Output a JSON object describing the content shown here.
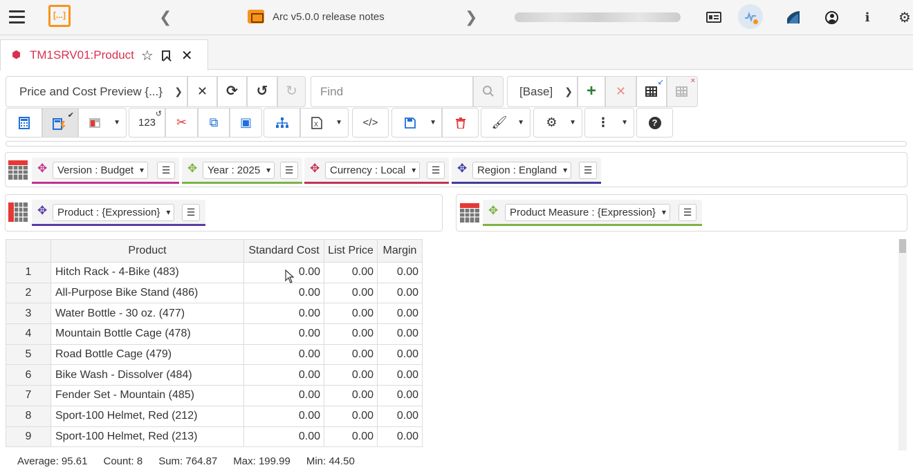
{
  "topbar": {
    "release_title": "Arc v5.0.0 release notes",
    "logo_text": "[...]"
  },
  "tab": {
    "title": "TM1SRV01:Product"
  },
  "toolbar": {
    "view_name": "Price and Cost Preview {...}",
    "find_placeholder": "Find",
    "base_select": "[Base]",
    "numbers_label": "123"
  },
  "context": [
    {
      "label": "Version : Budget",
      "color": "#c2338a"
    },
    {
      "label": "Year : 2025",
      "color": "#7cb342"
    },
    {
      "label": "Currency : Local",
      "color": "#c2334f"
    },
    {
      "label": "Region : England",
      "color": "#3f3ca0"
    }
  ],
  "rows_dim": {
    "label": "Product : {Expression}",
    "color": "#5a3ba5"
  },
  "columns_dim": {
    "label": "Product Measure : {Expression}",
    "color": "#7cb342"
  },
  "grid": {
    "headers": [
      "Product",
      "Standard Cost",
      "List Price",
      "Margin"
    ],
    "rows": [
      {
        "n": "1",
        "product": "Hitch Rack - 4-Bike (483)",
        "cost": "0.00",
        "price": "0.00",
        "margin": "0.00"
      },
      {
        "n": "2",
        "product": "All-Purpose Bike Stand (486)",
        "cost": "0.00",
        "price": "0.00",
        "margin": "0.00"
      },
      {
        "n": "3",
        "product": "Water Bottle - 30 oz. (477)",
        "cost": "0.00",
        "price": "0.00",
        "margin": "0.00"
      },
      {
        "n": "4",
        "product": "Mountain Bottle Cage (478)",
        "cost": "0.00",
        "price": "0.00",
        "margin": "0.00"
      },
      {
        "n": "5",
        "product": "Road Bottle Cage (479)",
        "cost": "0.00",
        "price": "0.00",
        "margin": "0.00"
      },
      {
        "n": "6",
        "product": "Bike Wash - Dissolver (484)",
        "cost": "0.00",
        "price": "0.00",
        "margin": "0.00"
      },
      {
        "n": "7",
        "product": "Fender Set - Mountain (485)",
        "cost": "0.00",
        "price": "0.00",
        "margin": "0.00"
      },
      {
        "n": "8",
        "product": "Sport-100 Helmet, Red (212)",
        "cost": "0.00",
        "price": "0.00",
        "margin": "0.00"
      },
      {
        "n": "9",
        "product": "Sport-100 Helmet, Red (213)",
        "cost": "0.00",
        "price": "0.00",
        "margin": "0.00"
      }
    ]
  },
  "status": {
    "average": "Average: 95.61",
    "count": "Count: 8",
    "sum": "Sum: 764.87",
    "max": "Max: 199.99",
    "min": "Min: 44.50"
  },
  "colors": {
    "accent": "#f7941d",
    "tab_title": "#d9304f",
    "blue_icon": "#1e6fd9",
    "red_icon": "#e53935"
  }
}
